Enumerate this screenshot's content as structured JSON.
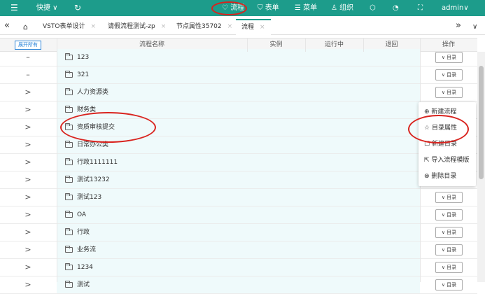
{
  "topbar": {
    "shortcut": "快捷",
    "flow": "流程",
    "form": "表单",
    "menu": "菜单",
    "org": "组织",
    "user": "admin"
  },
  "tabs": [
    {
      "label": "VSTO表单设计"
    },
    {
      "label": "请假流程测试-zp"
    },
    {
      "label": "节点属性35702"
    },
    {
      "label": "流程"
    }
  ],
  "table": {
    "expand_all": "展开所有",
    "columns": [
      "流程名称",
      "实例",
      "运行中",
      "退回",
      "操作"
    ],
    "dir_label": "目录",
    "rows": [
      {
        "toggle": "–",
        "name": "123"
      },
      {
        "toggle": "–",
        "name": "321"
      },
      {
        "toggle": ">",
        "name": "人力资源类"
      },
      {
        "toggle": ">",
        "name": "财务类"
      },
      {
        "toggle": ">",
        "name": "资质审核提交"
      },
      {
        "toggle": ">",
        "name": "日常办公类"
      },
      {
        "toggle": ">",
        "name": "行政1111111"
      },
      {
        "toggle": ">",
        "name": "测试13232"
      },
      {
        "toggle": ">",
        "name": "测试123"
      },
      {
        "toggle": ">",
        "name": "OA"
      },
      {
        "toggle": ">",
        "name": "行政"
      },
      {
        "toggle": ">",
        "name": "业务流"
      },
      {
        "toggle": ">",
        "name": "1234"
      },
      {
        "toggle": ">",
        "name": "测试"
      }
    ]
  },
  "context_menu": {
    "new_flow": "新建流程",
    "dir_props": "目录属性",
    "new_dir": "新建目录",
    "import_tpl": "导入流程模版",
    "delete_dir": "删除目录"
  },
  "colors": {
    "accent": "#1d9c8b",
    "highlight": "#d9231e"
  }
}
